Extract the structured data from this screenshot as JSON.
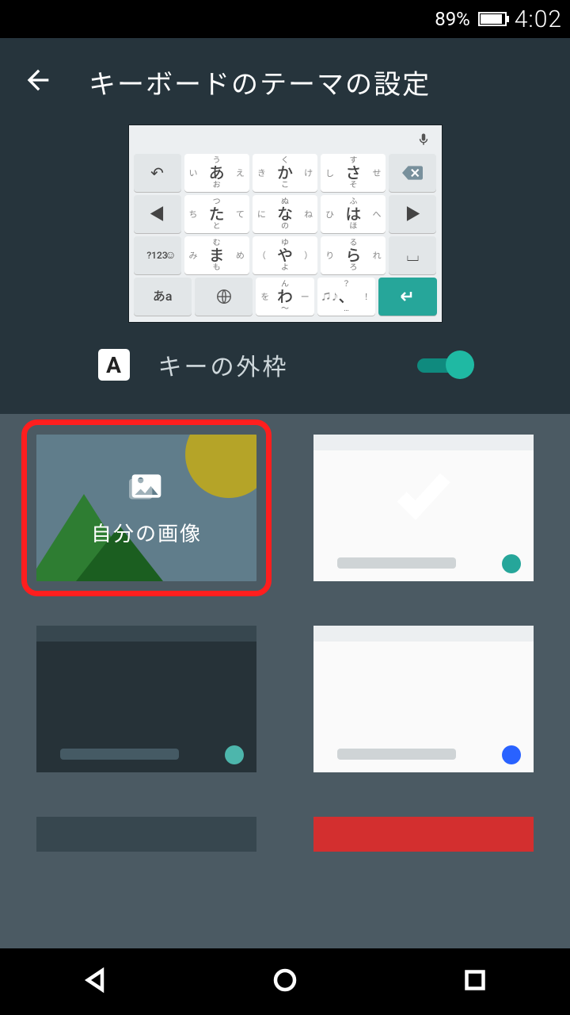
{
  "status": {
    "battery_pct": "89%",
    "time": "4:02"
  },
  "header": {
    "title": "キーボードのテーマの設定"
  },
  "keyboard_preview": {
    "rows": [
      {
        "kana": [
          {
            "l": "い",
            "c": "あ",
            "r": "え",
            "t": "う",
            "b": "お"
          },
          {
            "l": "き",
            "c": "か",
            "r": "け",
            "t": "く",
            "b": "こ"
          },
          {
            "l": "し",
            "c": "さ",
            "r": "せ",
            "t": "す",
            "b": "そ"
          }
        ]
      },
      {
        "kana": [
          {
            "l": "ち",
            "c": "た",
            "r": "て",
            "t": "つ",
            "b": "と"
          },
          {
            "l": "に",
            "c": "な",
            "r": "ね",
            "t": "ぬ",
            "b": "の"
          },
          {
            "l": "ひ",
            "c": "は",
            "r": "へ",
            "t": "ふ",
            "b": "ほ"
          }
        ]
      },
      {
        "kana": [
          {
            "l": "み",
            "c": "ま",
            "r": "め",
            "t": "む",
            "b": "も"
          },
          {
            "l": "（",
            "c": "や",
            "r": "）",
            "t": "ゆ",
            "b": "よ"
          },
          {
            "l": "り",
            "c": "ら",
            "r": "れ",
            "t": "る",
            "b": "ろ"
          }
        ]
      },
      {
        "kana": [
          {
            "l": "を",
            "c": "わ",
            "r": "ー",
            "t": "ん",
            "b": "〜"
          }
        ]
      }
    ],
    "func": {
      "undo": "↩",
      "left": "◀",
      "right": "▶",
      "sym": "?123",
      "globe": "⊕",
      "aa": "あa",
      "bksp": "⌫",
      "space": "⎵",
      "enter": "↩",
      "punct_l": "♫♪",
      "punct_r": "！",
      "punct_t": "？",
      "punct_b": "…"
    }
  },
  "toggle": {
    "badge": "A",
    "label": "キーの外枠",
    "on": true
  },
  "themes": {
    "custom_label": "自分の画像"
  }
}
